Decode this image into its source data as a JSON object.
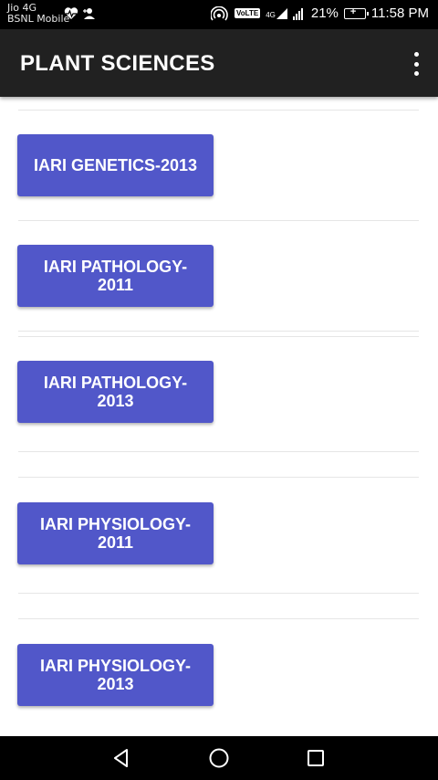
{
  "status_bar": {
    "carrier_line1": "Jio 4G",
    "carrier_line2": "BSNL Mobile",
    "volte": "VoLTE",
    "network": "4G",
    "battery_percent": "21%",
    "time": "11:58 PM"
  },
  "app_bar": {
    "title": "PLANT SCIENCES",
    "menu_icon": "more-vert-icon"
  },
  "items": [
    {
      "label": "IARI GENETICS-2013"
    },
    {
      "label": "IARI PATHOLOGY-2011"
    },
    {
      "label": "IARI PATHOLOGY-2013"
    },
    {
      "label": "IARI PHYSIOLOGY-2011"
    },
    {
      "label": "IARI PHYSIOLOGY-2013"
    }
  ],
  "nav_bar": {
    "back_icon": "back-triangle-icon",
    "home_icon": "home-circle-icon",
    "recents_icon": "recents-square-icon"
  },
  "colors": {
    "button": "#5157c9",
    "app_bar": "#212121",
    "status_bar": "#000000"
  }
}
